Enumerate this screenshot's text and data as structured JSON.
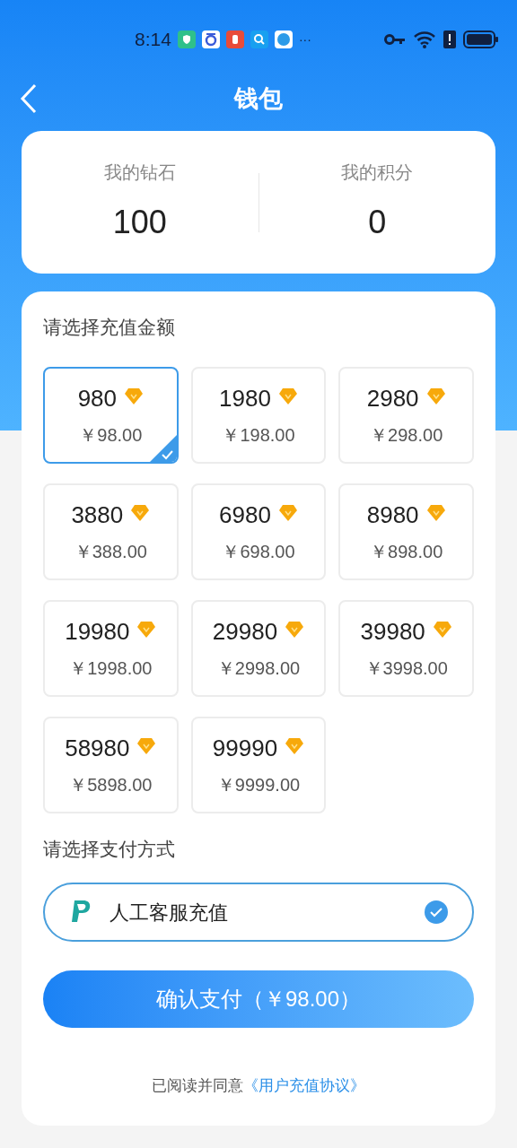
{
  "status_bar": {
    "time": "8:14",
    "more": "···"
  },
  "header": {
    "title": "钱包"
  },
  "balances": [
    {
      "label": "我的钻石",
      "value": "100"
    },
    {
      "label": "我的积分",
      "value": "0"
    }
  ],
  "recharge": {
    "title": "请选择充值金额",
    "packages": [
      {
        "diamonds": "980",
        "price": "￥98.00",
        "selected": true
      },
      {
        "diamonds": "1980",
        "price": "￥198.00",
        "selected": false
      },
      {
        "diamonds": "2980",
        "price": "￥298.00",
        "selected": false
      },
      {
        "diamonds": "3880",
        "price": "￥388.00",
        "selected": false
      },
      {
        "diamonds": "6980",
        "price": "￥698.00",
        "selected": false
      },
      {
        "diamonds": "8980",
        "price": "￥898.00",
        "selected": false
      },
      {
        "diamonds": "19980",
        "price": "￥1998.00",
        "selected": false
      },
      {
        "diamonds": "29980",
        "price": "￥2998.00",
        "selected": false
      },
      {
        "diamonds": "39980",
        "price": "￥3998.00",
        "selected": false
      },
      {
        "diamonds": "58980",
        "price": "￥5898.00",
        "selected": false
      },
      {
        "diamonds": "99990",
        "price": "￥9999.00",
        "selected": false
      }
    ]
  },
  "payment": {
    "title": "请选择支付方式",
    "methods": [
      {
        "label": "人工客服充值",
        "selected": true
      }
    ]
  },
  "confirm_button": "确认支付（￥98.00）",
  "agreement": {
    "text": "已阅读并同意",
    "link": "《用户充值协议》"
  }
}
